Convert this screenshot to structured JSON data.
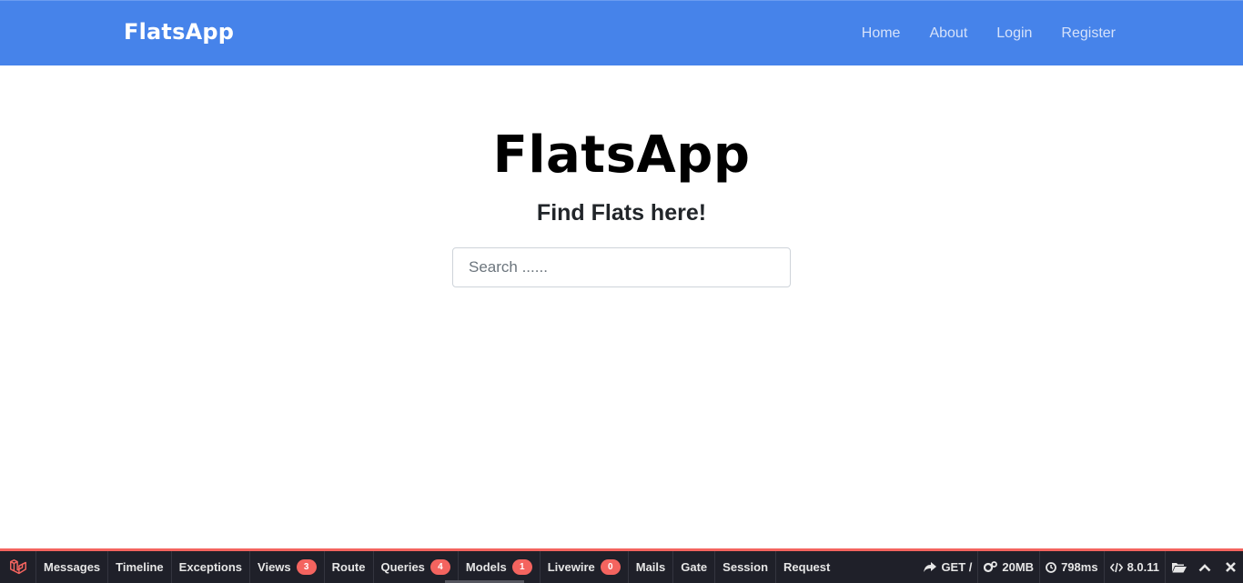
{
  "navbar": {
    "brand": "FlatsApp",
    "links": [
      {
        "label": "Home"
      },
      {
        "label": "About"
      },
      {
        "label": "Login"
      },
      {
        "label": "Register"
      }
    ],
    "background": "#4683ea"
  },
  "hero": {
    "title": "FlatsApp",
    "subtitle": "Find Flats here!",
    "search": {
      "placeholder": "Search ......",
      "value": ""
    }
  },
  "debugbar": {
    "logo_icon": "laravel-icon",
    "accent": "#f4645f",
    "tabs": [
      {
        "label": "Messages",
        "badge": null
      },
      {
        "label": "Timeline",
        "badge": null
      },
      {
        "label": "Exceptions",
        "badge": null
      },
      {
        "label": "Views",
        "badge": "3"
      },
      {
        "label": "Route",
        "badge": null
      },
      {
        "label": "Queries",
        "badge": "4"
      },
      {
        "label": "Models",
        "badge": "1"
      },
      {
        "label": "Livewire",
        "badge": "0"
      },
      {
        "label": "Mails",
        "badge": null
      },
      {
        "label": "Gate",
        "badge": null
      },
      {
        "label": "Session",
        "badge": null
      },
      {
        "label": "Request",
        "badge": null
      }
    ],
    "stats": {
      "request": "GET /",
      "memory": "20MB",
      "time": "798ms",
      "version": "8.0.11"
    }
  }
}
